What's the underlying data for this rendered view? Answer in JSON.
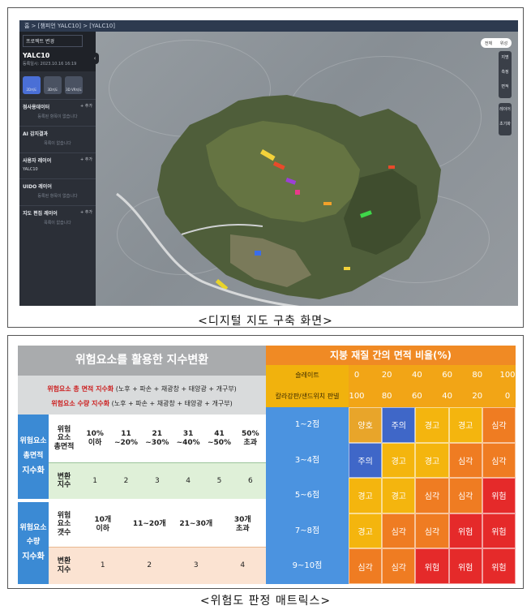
{
  "map_view": {
    "breadcrumb": "홈 > [챔피언 YALC10] > [YALC10]",
    "panel": {
      "project_button": "프로젝트 변경",
      "project_title": "YALC10",
      "project_date": "등록일시: 2023.10.16 16:19",
      "modes": [
        "2D지도",
        "3D지도",
        "3D VR지도"
      ],
      "sections": [
        {
          "title": "점사용데이터",
          "add": "+ 추가",
          "empty": "등록된 항목이 없습니다"
        },
        {
          "title": "AI 감지결과",
          "add": "",
          "empty": "목록이 없습니다"
        },
        {
          "title": "사용자 레이어",
          "add": "+ 추가",
          "empty": "YALC10"
        },
        {
          "title": "UIDO 레이어",
          "add": "",
          "empty": "등록된 항목이 없습니다"
        },
        {
          "title": "지도 편집 레이어",
          "add": "+ 추가",
          "empty": "목록이 없습니다"
        }
      ]
    },
    "tool_pill": [
      "전체",
      "위성"
    ],
    "tools": [
      "지명",
      "측정",
      "면적",
      "레이어",
      "초기화"
    ]
  },
  "caption_top": "<디지털 지도 구축 화면>",
  "matrix": {
    "left_title": "위험요소를 활용한 지수변환",
    "formula_1_red": "위험요소 총 면적 지수화",
    "formula_1_rest": "(노후 + 파손 + 채광창 + 태양광 + 개구부)",
    "formula_2_red": "위험요소 수량 지수화",
    "formula_2_rest": "(노후 + 파손 + 채광창 + 태양광 + 개구부)",
    "area_group": {
      "label_1": "위험요소",
      "label_2": "총면적",
      "label_3": "지수화",
      "row1_label": "위험\n요소\n총면적",
      "row1_values": [
        "10%\n이하",
        "11\n~20%",
        "21\n~30%",
        "31\n~40%",
        "41\n~50%",
        "50%\n초과"
      ],
      "row2_label": "변환\n지수",
      "row2_values": [
        "1",
        "2",
        "3",
        "4",
        "5",
        "6"
      ]
    },
    "count_group": {
      "label_1": "위험요소",
      "label_2": "수량",
      "label_3": "지수화",
      "row1_label": "위험\n요소\n갯수",
      "row1_values": [
        "10개\n이하",
        "11~20개",
        "21~30개",
        "30개\n초과"
      ],
      "row2_label": "변환\n지수",
      "row2_values": [
        "1",
        "2",
        "3",
        "4"
      ]
    },
    "right_title": "지붕 재질 간의 면적 비율(%)",
    "slate_label": "슬레이트",
    "slate_scale": [
      "0",
      "20",
      "40",
      "60",
      "80",
      "100"
    ],
    "steel_label": "칼라강판/샌드위치 판넬",
    "steel_scale": [
      "100",
      "80",
      "60",
      "40",
      "20",
      "0"
    ],
    "scores": [
      "1~2점",
      "3~4점",
      "5~6점",
      "7~8점",
      "9~10점"
    ],
    "levels": {
      "양호": "#e8a52a",
      "주의": "#3f67c8",
      "경고": "#f4b50e",
      "심각": "#ef7c22",
      "위험": "#e52a2a"
    },
    "grid": [
      [
        "양호",
        "주의",
        "경고",
        "경고",
        "심각"
      ],
      [
        "주의",
        "경고",
        "경고",
        "심각",
        "심각"
      ],
      [
        "경고",
        "경고",
        "심각",
        "심각",
        "위험"
      ],
      [
        "경고",
        "심각",
        "심각",
        "위험",
        "위험"
      ],
      [
        "심각",
        "심각",
        "위험",
        "위험",
        "위험"
      ]
    ]
  },
  "caption_bottom": "<위험도 판정 매트릭스>"
}
